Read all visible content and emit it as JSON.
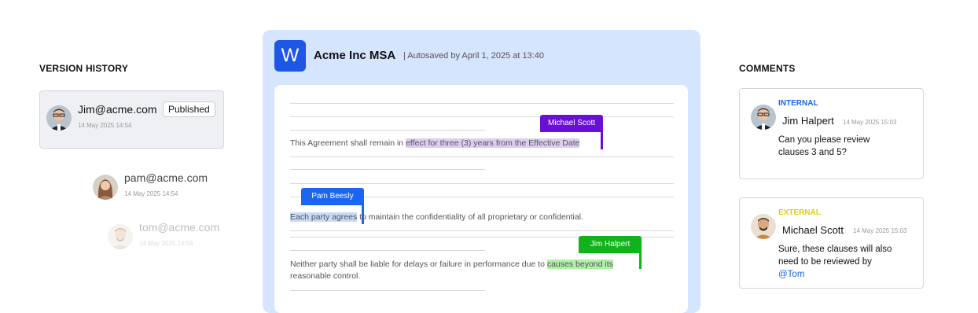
{
  "version_history": {
    "title": "VERSION HISTORY",
    "entries": [
      {
        "email": "Jim@acme.com",
        "date": "14 May 2025 14:54",
        "badge": "Published"
      },
      {
        "email": "pam@acme.com",
        "date": "14 May 2025 14:54"
      },
      {
        "email": "tom@acme.com",
        "date": "14 May 2025 14:54"
      }
    ]
  },
  "document": {
    "logo_letter": "W",
    "title": "Acme Inc MSA",
    "autosave": "| Autosaved by April 1, 2025 at 13:40",
    "para1": {
      "before": "This Agreement shall remain in ",
      "highlight": "effect for three (3) years from the Effective Date",
      "author": "Michael Scott"
    },
    "para2": {
      "highlight": "Each party agrees",
      "after": " to maintain the confidentiality of all proprietary or confidential.",
      "author": "Pam Beesly"
    },
    "para3": {
      "before": "Neither party shall be liable for delays or failure in performance due to ",
      "highlight": "causes beyond its",
      "after": " reasonable control.",
      "author": "Jim Halpert"
    }
  },
  "comments": {
    "title": "COMMENTS",
    "items": [
      {
        "type": "INTERNAL",
        "type_color": "#1a66e0",
        "name": "Jim Halpert",
        "date": "14 May 2025 15:03",
        "text": "Can you please review clauses 3 and 5?"
      },
      {
        "type": "EXTERNAL",
        "type_color": "#e0d00c",
        "name": "Michael Scott",
        "date": "14 May 2025 15:03",
        "text": "Sure, these clauses will also need to be reviewed by",
        "mention": "@Tom"
      }
    ]
  },
  "colors": {
    "purple": "#6a10d6",
    "blue": "#1a66f0",
    "green": "#10b41a",
    "brand": "#1e56e6"
  }
}
